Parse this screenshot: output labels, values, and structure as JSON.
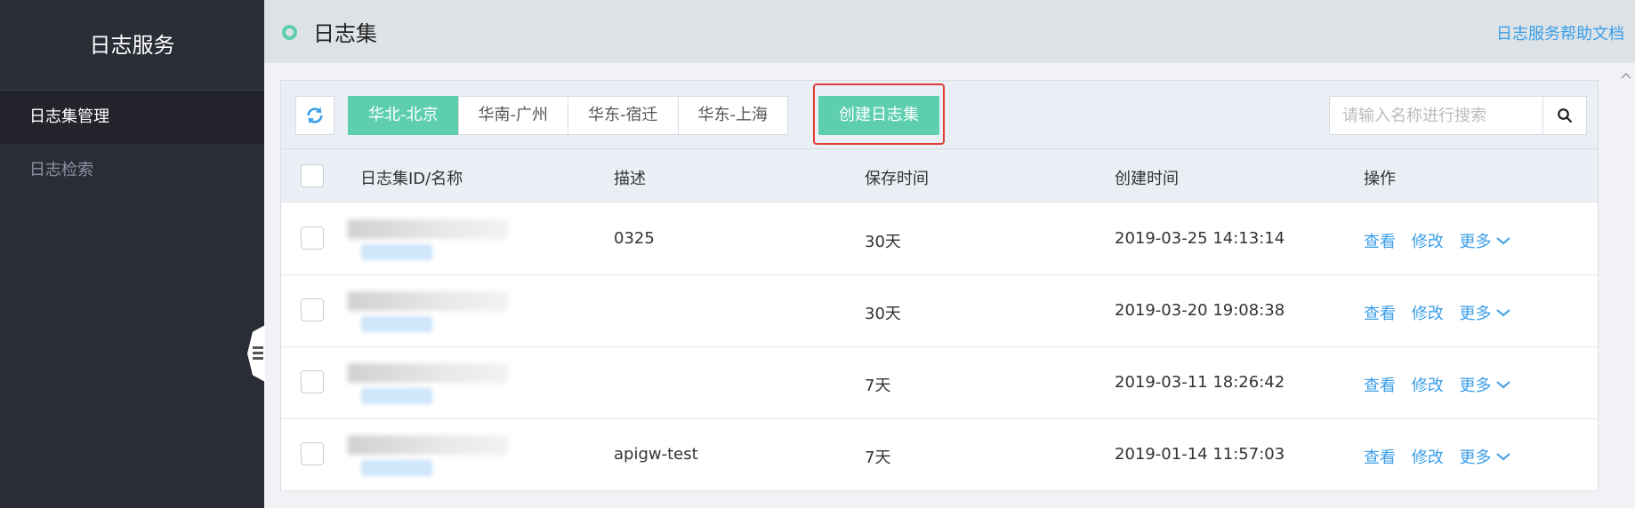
{
  "sidebar": {
    "title": "日志服务",
    "items": [
      {
        "label": "日志集管理",
        "active": true
      },
      {
        "label": "日志检索",
        "active": false
      }
    ]
  },
  "header": {
    "title": "日志集",
    "help_link": "日志服务帮助文档"
  },
  "toolbar": {
    "regions": [
      "华北-北京",
      "华南-广州",
      "华东-宿迁",
      "华东-上海"
    ],
    "active_region": "华北-北京",
    "create_label": "创建日志集",
    "search_placeholder": "请输入名称进行搜索"
  },
  "table": {
    "columns": [
      "日志集ID/名称",
      "描述",
      "保存时间",
      "创建时间",
      "操作"
    ],
    "actions": {
      "view": "查看",
      "edit": "修改",
      "more": "更多"
    },
    "rows": [
      {
        "description": "0325",
        "retention": "30天",
        "created": "2019-03-25 14:13:14"
      },
      {
        "description": "",
        "retention": "30天",
        "created": "2019-03-20 19:08:38"
      },
      {
        "description": "",
        "retention": "7天",
        "created": "2019-03-11 18:26:42"
      },
      {
        "description": "apigw-test",
        "retention": "7天",
        "created": "2019-01-14 11:57:03"
      }
    ]
  },
  "colors": {
    "accent": "#5dcfae",
    "link": "#3a9ee8",
    "sidebar_bg": "#2a2c36",
    "highlight": "#e53935"
  }
}
